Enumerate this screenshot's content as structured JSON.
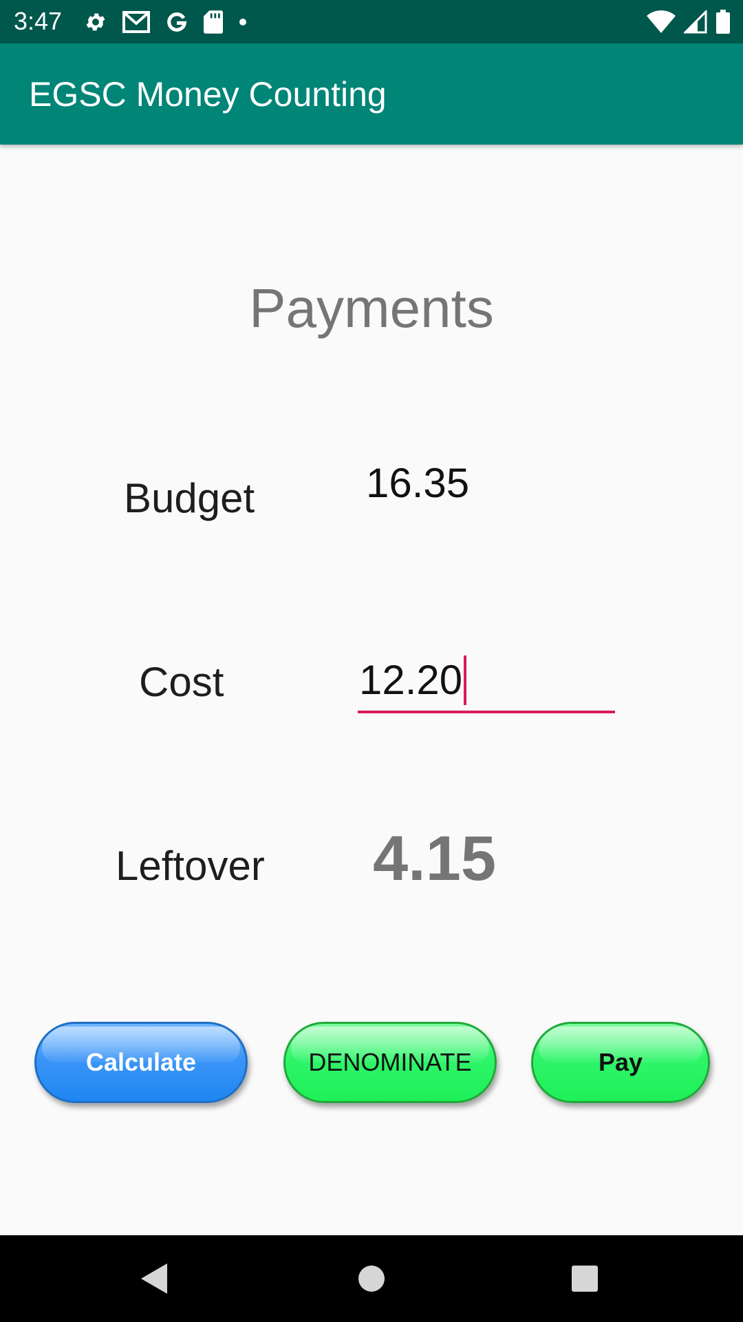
{
  "status_bar": {
    "time": "3:47",
    "left_icons": [
      "settings-icon",
      "gmail-icon",
      "google-icon",
      "sd-card-icon",
      "dot-icon"
    ],
    "right_icons": [
      "wifi-icon",
      "cellular-signal-icon",
      "battery-icon"
    ]
  },
  "app_bar": {
    "title": "EGSC Money Counting"
  },
  "main": {
    "heading": "Payments",
    "budget": {
      "label": "Budget",
      "value": "16.35"
    },
    "cost": {
      "label": "Cost",
      "value": "12.20"
    },
    "leftover": {
      "label": "Leftover",
      "value": "4.15"
    }
  },
  "buttons": {
    "calculate": "Calculate",
    "denominate": "DENOMINATE",
    "pay": "Pay"
  },
  "nav_bar": {
    "icons": [
      "back-icon",
      "home-icon",
      "recents-icon"
    ]
  },
  "colors": {
    "status_bar": "#00574b",
    "app_bar": "#008577",
    "accent": "#d81b60",
    "calculate_button": "#1f86f2",
    "green_buttons": "#1fef58"
  }
}
